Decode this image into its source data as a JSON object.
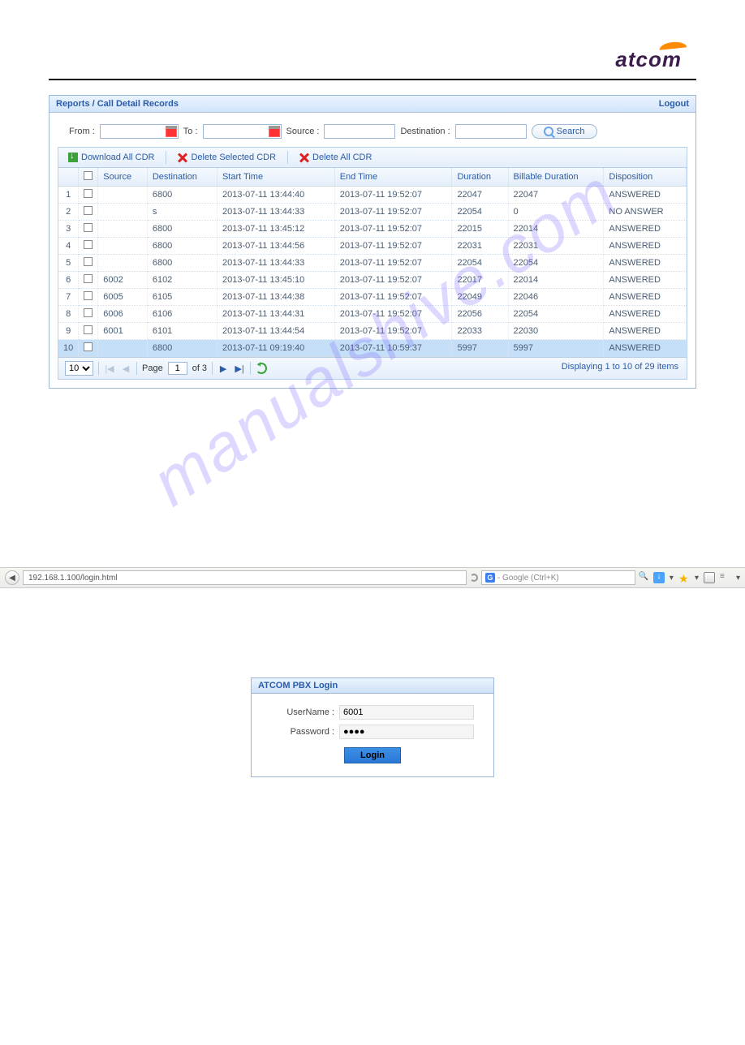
{
  "brand": {
    "name": "atcom"
  },
  "panel": {
    "crumb_root": "Reports",
    "crumb_sep": " / ",
    "crumb_leaf": "Call Detail Records",
    "logout": "Logout"
  },
  "filters": {
    "from_label": "From :",
    "to_label": "To :",
    "source_label": "Source :",
    "dest_label": "Destination :",
    "search_label": "Search",
    "from_val": "",
    "to_val": "",
    "source_val": "",
    "dest_val": ""
  },
  "toolbar": {
    "download_label": "Download All CDR",
    "delete_sel_label": "Delete Selected CDR",
    "delete_all_label": "Delete All CDR"
  },
  "columns": {
    "idx": "",
    "chk": "",
    "source": "Source",
    "dest": "Destination",
    "start": "Start Time",
    "end": "End Time",
    "dur": "Duration",
    "bill": "Billable Duration",
    "disp": "Disposition"
  },
  "rows": [
    {
      "n": "1",
      "src": "",
      "dst": "6800",
      "st": "2013-07-11 13:44:40",
      "et": "2013-07-11 19:52:07",
      "dur": "22047",
      "bill": "22047",
      "disp": "ANSWERED",
      "sel": false
    },
    {
      "n": "2",
      "src": "",
      "dst": "s",
      "st": "2013-07-11 13:44:33",
      "et": "2013-07-11 19:52:07",
      "dur": "22054",
      "bill": "0",
      "disp": "NO ANSWER",
      "sel": false
    },
    {
      "n": "3",
      "src": "",
      "dst": "6800",
      "st": "2013-07-11 13:45:12",
      "et": "2013-07-11 19:52:07",
      "dur": "22015",
      "bill": "22014",
      "disp": "ANSWERED",
      "sel": false
    },
    {
      "n": "4",
      "src": "",
      "dst": "6800",
      "st": "2013-07-11 13:44:56",
      "et": "2013-07-11 19:52:07",
      "dur": "22031",
      "bill": "22031",
      "disp": "ANSWERED",
      "sel": false
    },
    {
      "n": "5",
      "src": "",
      "dst": "6800",
      "st": "2013-07-11 13:44:33",
      "et": "2013-07-11 19:52:07",
      "dur": "22054",
      "bill": "22054",
      "disp": "ANSWERED",
      "sel": false
    },
    {
      "n": "6",
      "src": "6002",
      "dst": "6102",
      "st": "2013-07-11 13:45:10",
      "et": "2013-07-11 19:52:07",
      "dur": "22017",
      "bill": "22014",
      "disp": "ANSWERED",
      "sel": false
    },
    {
      "n": "7",
      "src": "6005",
      "dst": "6105",
      "st": "2013-07-11 13:44:38",
      "et": "2013-07-11 19:52:07",
      "dur": "22049",
      "bill": "22046",
      "disp": "ANSWERED",
      "sel": false
    },
    {
      "n": "8",
      "src": "6006",
      "dst": "6106",
      "st": "2013-07-11 13:44:31",
      "et": "2013-07-11 19:52:07",
      "dur": "22056",
      "bill": "22054",
      "disp": "ANSWERED",
      "sel": false
    },
    {
      "n": "9",
      "src": "6001",
      "dst": "6101",
      "st": "2013-07-11 13:44:54",
      "et": "2013-07-11 19:52:07",
      "dur": "22033",
      "bill": "22030",
      "disp": "ANSWERED",
      "sel": false
    },
    {
      "n": "10",
      "src": "",
      "dst": "6800",
      "st": "2013-07-11 09:19:40",
      "et": "2013-07-11 10:59:37",
      "dur": "5997",
      "bill": "5997",
      "disp": "ANSWERED",
      "sel": true
    }
  ],
  "pager": {
    "page_size": "10",
    "page_word": "Page",
    "page_cur": "1",
    "of_word": "of 3",
    "status": "Displaying 1 to 10 of 29 items"
  },
  "browser": {
    "url": "192.168.1.100/login.html",
    "search_placeholder": "- Google (Ctrl+K)"
  },
  "login": {
    "title": "ATCOM PBX Login",
    "user_label": "UserName :",
    "user_val": "6001",
    "pass_label": "Password :",
    "pass_val": "●●●●",
    "btn": "Login"
  },
  "watermark": "manualshive.com"
}
